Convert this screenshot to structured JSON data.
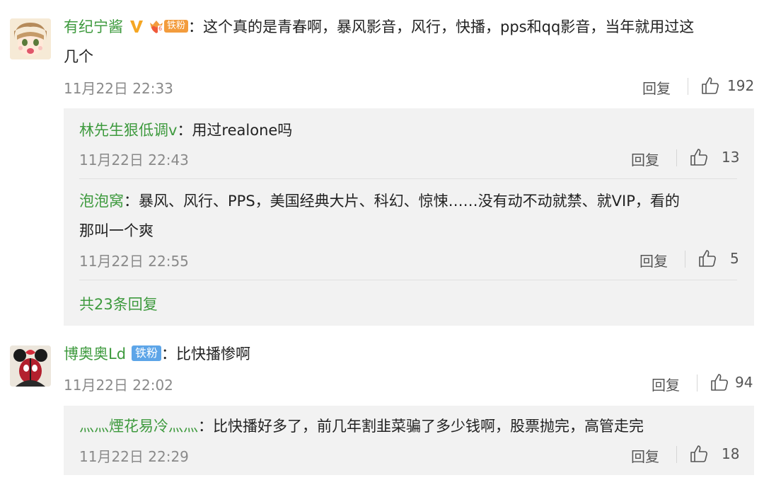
{
  "comment1": {
    "user": "有纪宁酱",
    "verified_badge": "V",
    "fan_badge": "铁粉",
    "fan_badge_mark": "6",
    "colon": "：",
    "text_line1": "这个真的是青春啊，暴风影音，风行，快播，pps和qq影音，当年就用过这",
    "text_line2": "几个",
    "time": "11月22日 22:33",
    "reply_label": "回复",
    "likes": "192"
  },
  "comment1_replies": [
    {
      "user": "林先生狠低调v",
      "colon": "：",
      "text_line1": "用过realone吗",
      "time": "11月22日 22:43",
      "reply_label": "回复",
      "likes": "13"
    },
    {
      "user": "泡泡窝",
      "colon": "：",
      "text_line1": "暴风、风行、PPS，美国经典大片、科幻、惊悚……没有动不动就禁、就VIP，看的",
      "text_line2": "那叫一个爽",
      "time": "11月22日 22:55",
      "reply_label": "回复",
      "likes": "5"
    }
  ],
  "comment1_more": "共23条回复",
  "comment2": {
    "user": "博奥奥Ld",
    "fan_badge": "铁粉",
    "colon": "：",
    "text_line1": "比快播惨啊",
    "time": "11月22日 22:02",
    "reply_label": "回复",
    "likes": "94"
  },
  "comment2_reply": {
    "user": "灬灬煙花易冷灬灬",
    "colon": "：",
    "text_line1": "比快播好多了，前几年割韭菜骗了多少钱啊，股票抛完，高管走完",
    "time": "11月22日 22:29",
    "reply_label": "回复",
    "likes": "18"
  },
  "colors": {
    "username": "#3e9a3e",
    "reply_background": "#f2f2f2",
    "verified": "#f5a623",
    "fan_badge_orange": "#f39c3d",
    "fan_badge_blue": "#5da5e8"
  }
}
